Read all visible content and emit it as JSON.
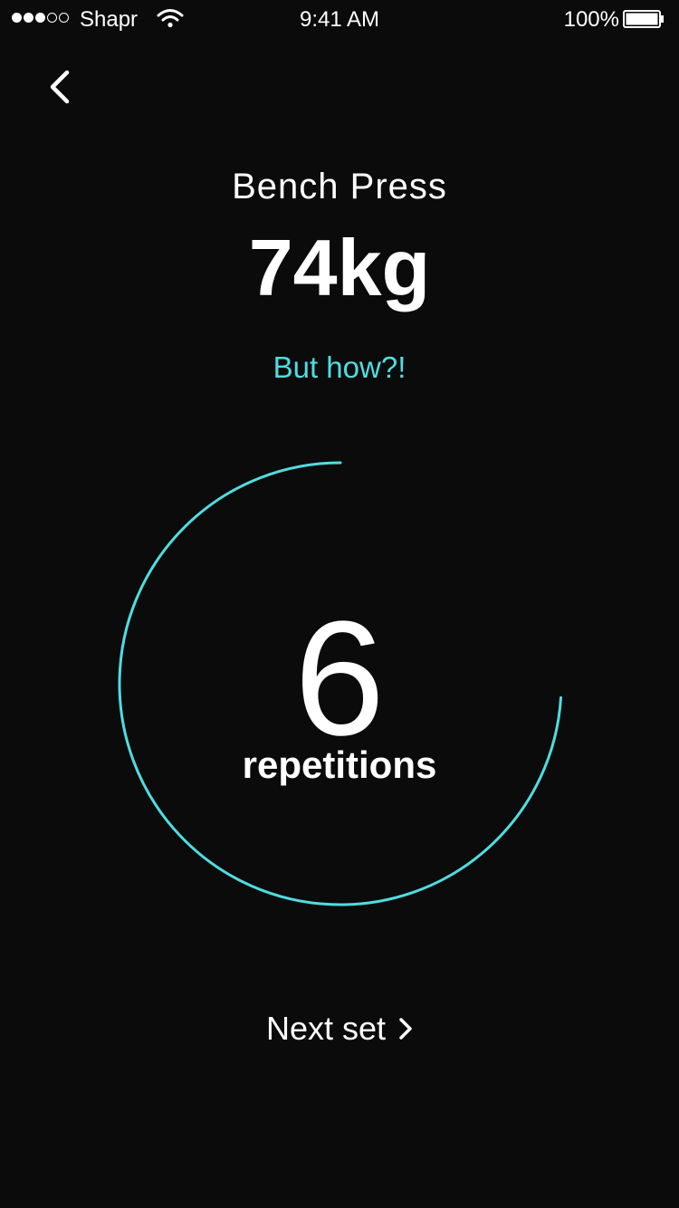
{
  "status_bar": {
    "carrier": "Shapr",
    "signal_bars_filled": 3,
    "signal_bars_total": 5,
    "time": "9:41 AM",
    "battery_percent": "100%",
    "battery_level": 1.0,
    "icons": [
      "signal-dots-icon",
      "wifi-icon",
      "battery-icon"
    ]
  },
  "nav": {
    "back_icon": "chevron-left-icon"
  },
  "exercise": {
    "name": "Bench Press",
    "weight": "74kg",
    "how_link": "But how?!"
  },
  "progress": {
    "count": "6",
    "label": "repetitions",
    "fraction": 0.74
  },
  "actions": {
    "next_set_label": "Next set",
    "next_icon": "chevron-right-icon"
  },
  "colors": {
    "background": "#0b0b0c",
    "text": "#ffffff",
    "accent": "#4fdde0"
  }
}
